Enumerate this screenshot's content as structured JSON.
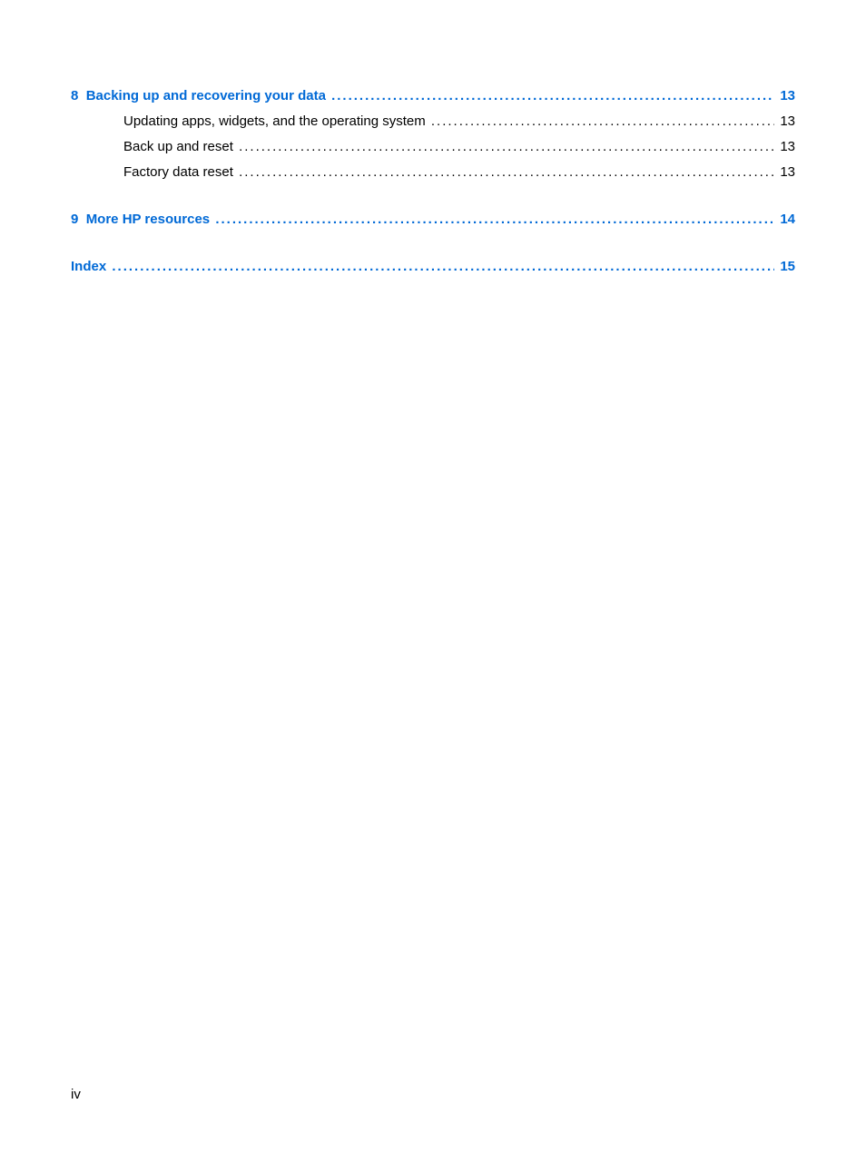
{
  "toc": {
    "chapter8": {
      "number": "8",
      "title": "Backing up and recovering your data",
      "page": "13",
      "items": [
        {
          "title": "Updating apps, widgets, and the operating system",
          "page": "13"
        },
        {
          "title": "Back up and reset",
          "page": "13"
        },
        {
          "title": "Factory data reset",
          "page": "13"
        }
      ]
    },
    "chapter9": {
      "number": "9",
      "title": "More HP resources",
      "page": "14"
    },
    "index": {
      "title": "Index",
      "page": "15"
    }
  },
  "footer": {
    "page_label": "iv"
  }
}
